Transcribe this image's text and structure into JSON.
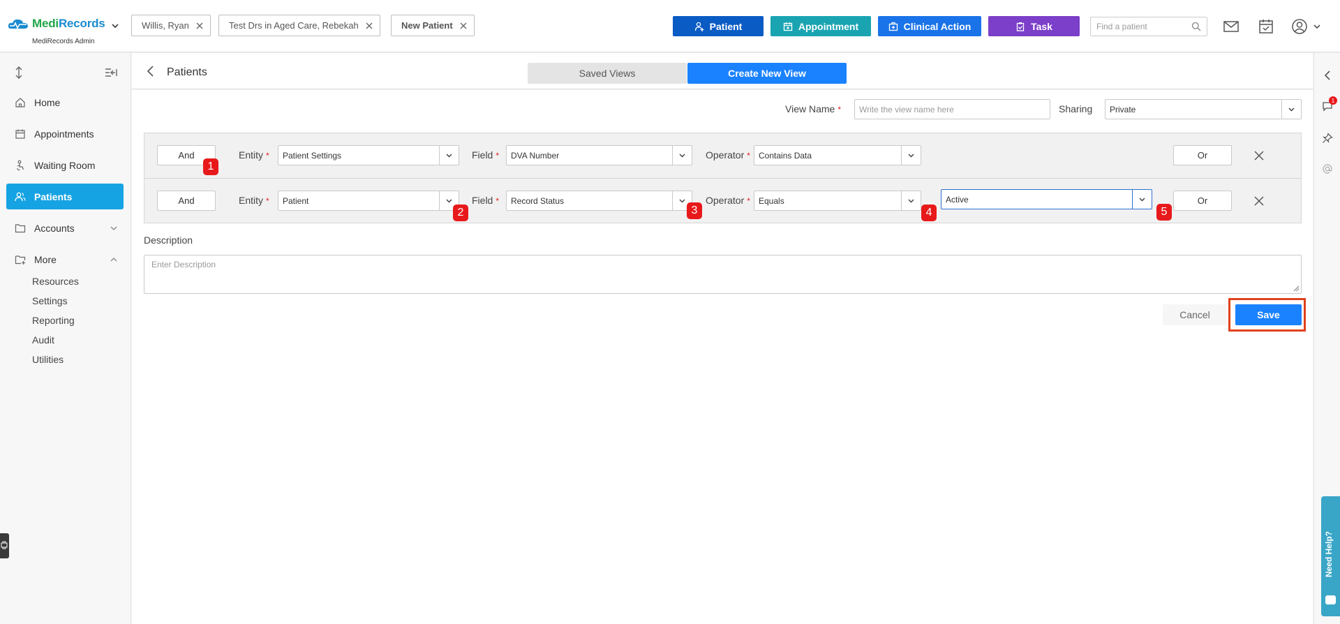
{
  "app": {
    "logo_text_medi": "Medi",
    "logo_text_records": "Records",
    "logo_sub": "MediRecords Admin"
  },
  "patient_tabs": [
    {
      "label": "Willis, Ryan"
    },
    {
      "label": "Test Drs in Aged Care, Rebekah"
    },
    {
      "label": "New Patient"
    }
  ],
  "header_buttons": {
    "patient": "Patient",
    "appointment": "Appointment",
    "clinical_action": "Clinical Action",
    "task": "Task"
  },
  "search": {
    "placeholder": "Find a patient"
  },
  "colors": {
    "patient": "#0a5bc4",
    "appointment": "#1aa4b2",
    "clinical_action": "#1a73e8",
    "task": "#7b3fc9",
    "accent": "#1a82ff",
    "active_nav": "#16a3e3",
    "badge": "#e8191b",
    "highlight_border": "#e0421b"
  },
  "sidebar": {
    "items": [
      {
        "label": "Home",
        "icon": "home-icon"
      },
      {
        "label": "Appointments",
        "icon": "calendar-icon"
      },
      {
        "label": "Waiting Room",
        "icon": "waiting-room-icon"
      },
      {
        "label": "Patients",
        "icon": "users-icon"
      },
      {
        "label": "Accounts",
        "icon": "folder-icon"
      },
      {
        "label": "More",
        "icon": "folder-plus-icon"
      }
    ],
    "more_items": [
      "Resources",
      "Settings",
      "Reporting",
      "Audit",
      "Utilities"
    ]
  },
  "subheader": {
    "title": "Patients",
    "tabs": [
      "Saved Views",
      "Create New View"
    ]
  },
  "form": {
    "view_name_label": "View Name",
    "view_name_placeholder": "Write the view name here",
    "sharing_label": "Sharing",
    "sharing_value": "Private",
    "required_mark": "*",
    "entity_label": "Entity",
    "field_label": "Field",
    "operator_label": "Operator",
    "and_label": "And",
    "or_label": "Or",
    "rules": [
      {
        "entity": "Patient Settings",
        "field": "DVA Number",
        "operator": "Contains Data"
      },
      {
        "entity": "Patient",
        "field": "Record Status",
        "operator": "Equals",
        "value": "Active"
      }
    ],
    "description_label": "Description",
    "description_placeholder": "Enter Description",
    "cancel_label": "Cancel",
    "save_label": "Save"
  },
  "badges": [
    "1",
    "2",
    "3",
    "4",
    "5"
  ],
  "rail": {
    "notification_count": "1"
  },
  "help": {
    "label": "Need Help?"
  }
}
